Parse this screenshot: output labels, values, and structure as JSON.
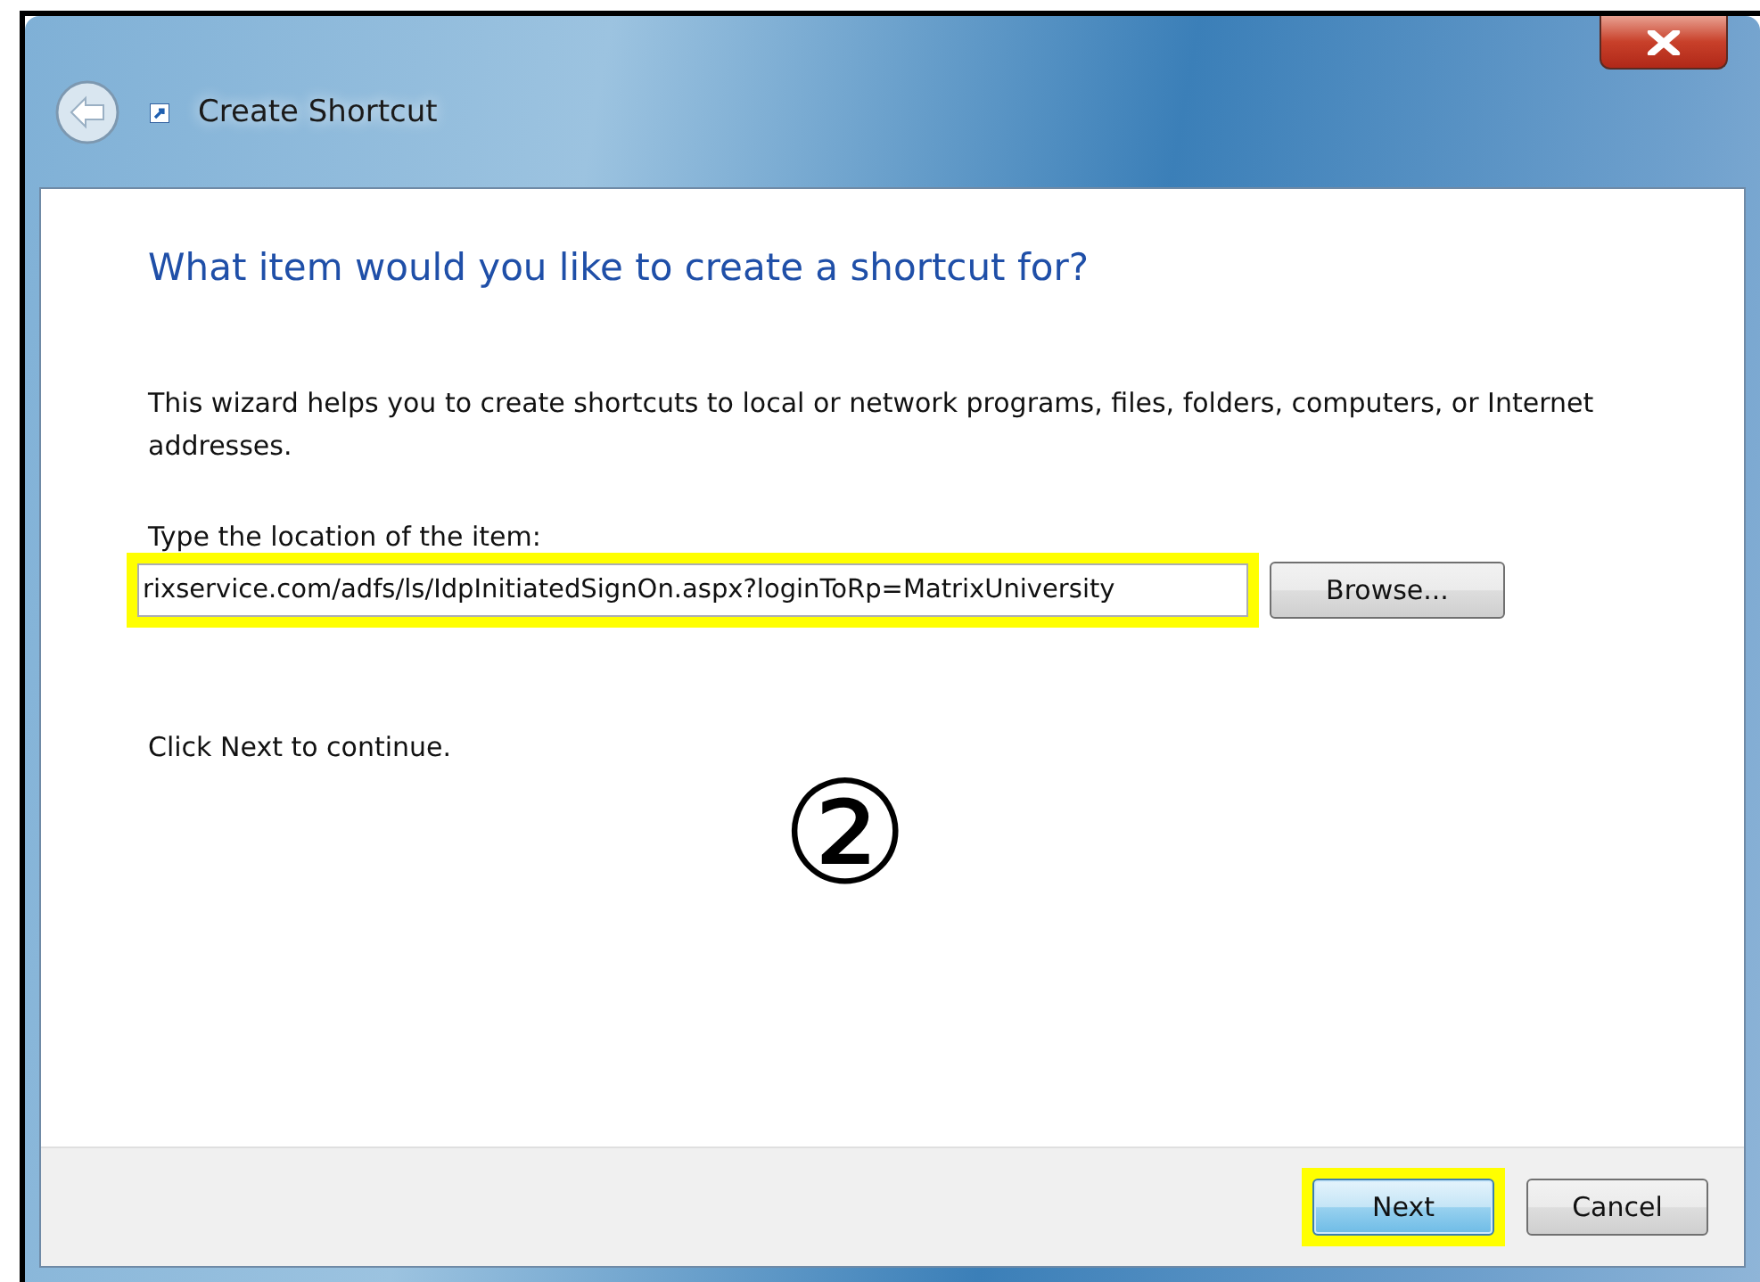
{
  "window": {
    "title": "Create Shortcut"
  },
  "heading": "What item would you like to create a shortcut for?",
  "description": "This wizard helps you to create shortcuts to local or network programs, files, folders, computers, or Internet addresses.",
  "location": {
    "label": "Type the location of the item:",
    "value": "rixservice.com/adfs/ls/IdpInitiatedSignOn.aspx?loginToRp=MatrixUniversity",
    "highlighted": true
  },
  "browse_button": "Browse...",
  "hint": "Click Next to continue.",
  "annotation": "②",
  "buttons": [
    {
      "label": "Next",
      "kind": "default",
      "highlighted": true
    },
    {
      "label": "Cancel",
      "kind": "normal",
      "highlighted": false
    }
  ]
}
